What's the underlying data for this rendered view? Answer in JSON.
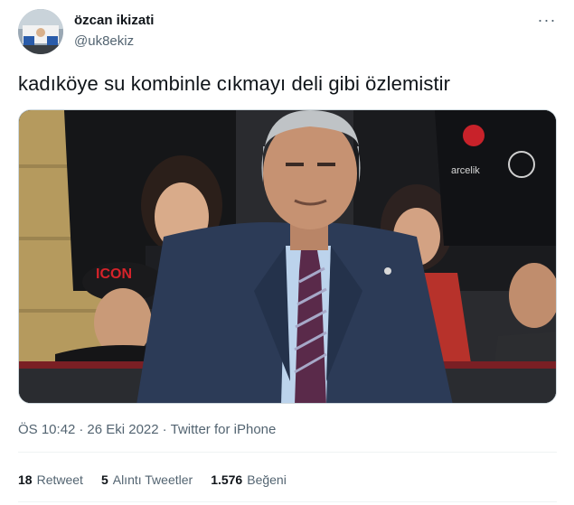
{
  "user": {
    "display_name": "özcan ikizati",
    "handle": "@uk8ekiz",
    "avatar_icon": "avatar-photo"
  },
  "more_icon": "···",
  "tweet": {
    "text": "kadıköye su kombinle cıkmayı deli gibi özlemistir"
  },
  "media": {
    "shirt_logo_text": "ICON",
    "sponsor_text": "arcelik"
  },
  "meta": {
    "time": "ÖS 10:42",
    "separator1": "·",
    "date": "26 Eki 2022",
    "separator2": "·",
    "source": "Twitter for iPhone"
  },
  "stats": {
    "retweets_count": "18",
    "retweets_label": "Retweet",
    "quotes_count": "5",
    "quotes_label": "Alıntı Tweetler",
    "likes_count": "1.576",
    "likes_label": "Beğeni"
  },
  "colors": {
    "text_primary": "#0f1419",
    "text_secondary": "#536471",
    "border": "#cfd9de"
  }
}
